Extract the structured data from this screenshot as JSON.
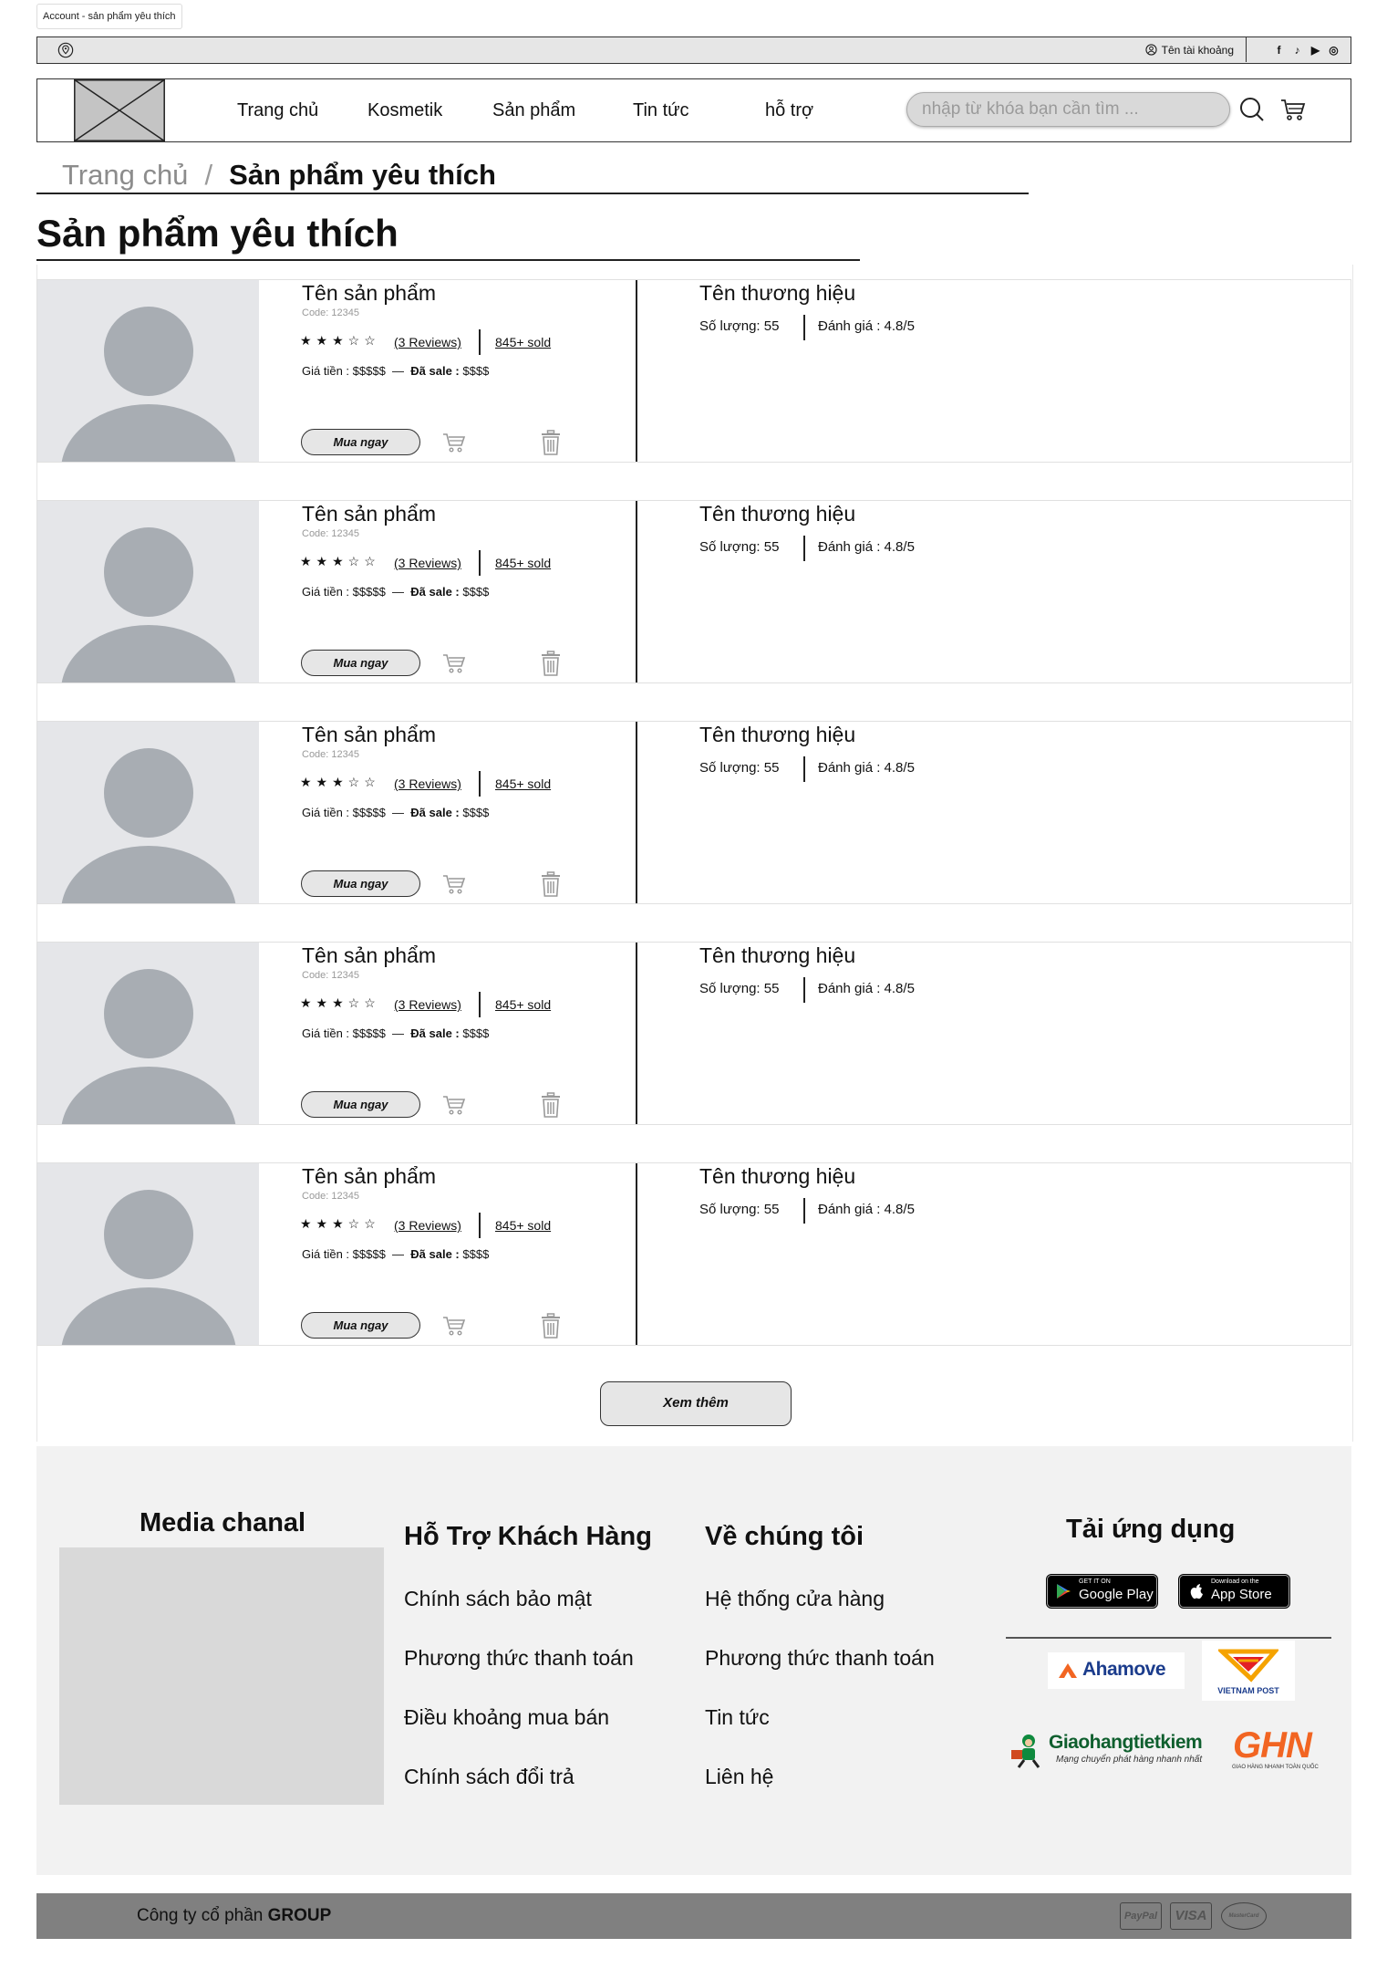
{
  "page_label": "Account - sản phẩm yêu thích",
  "topbar": {
    "account_name": "Tên tài khoảng",
    "socials": [
      "facebook-icon",
      "tiktok-icon",
      "youtube-icon",
      "instagram-icon"
    ]
  },
  "header": {
    "nav": [
      "Trang chủ",
      "Kosmetik",
      "Sản phẩm",
      "Tin tức",
      "hỗ trợ"
    ],
    "search_placeholder": "nhập từ khóa bạn cần tìm ..."
  },
  "breadcrumb": {
    "home": "Trang chủ",
    "separator": "/",
    "current": "Sản phẩm yêu thích"
  },
  "page_title": "Sản phẩm yêu thích",
  "products": [
    {
      "name": "Tên sản phẩm",
      "code": "Code: 12345",
      "stars": "★★★☆☆",
      "reviews": "(3 Reviews)",
      "sold": "845+ sold",
      "price_label": "Giá tiền :",
      "price": "$$$$$",
      "dash": "—",
      "sale_label": "Đã sale :",
      "sale": "$$$$",
      "buy": "Mua ngay",
      "brand": "Tên thương hiệu",
      "quantity": "Số lượng: 55",
      "rating": "Đánh giá : 4.8/5"
    },
    {
      "name": "Tên sản phẩm",
      "code": "Code: 12345",
      "stars": "★★★☆☆",
      "reviews": "(3 Reviews)",
      "sold": "845+ sold",
      "price_label": "Giá tiền :",
      "price": "$$$$$",
      "dash": "—",
      "sale_label": "Đã sale :",
      "sale": "$$$$",
      "buy": "Mua ngay",
      "brand": "Tên thương hiệu",
      "quantity": "Số lượng: 55",
      "rating": "Đánh giá : 4.8/5"
    },
    {
      "name": "Tên sản phẩm",
      "code": "Code: 12345",
      "stars": "★★★☆☆",
      "reviews": "(3 Reviews)",
      "sold": "845+ sold",
      "price_label": "Giá tiền :",
      "price": "$$$$$",
      "dash": "—",
      "sale_label": "Đã sale :",
      "sale": "$$$$",
      "buy": "Mua ngay",
      "brand": "Tên thương hiệu",
      "quantity": "Số lượng: 55",
      "rating": "Đánh giá : 4.8/5"
    },
    {
      "name": "Tên sản phẩm",
      "code": "Code: 12345",
      "stars": "★★★☆☆",
      "reviews": "(3 Reviews)",
      "sold": "845+ sold",
      "price_label": "Giá tiền :",
      "price": "$$$$$",
      "dash": "—",
      "sale_label": "Đã sale :",
      "sale": "$$$$",
      "buy": "Mua ngay",
      "brand": "Tên thương hiệu",
      "quantity": "Số lượng: 55",
      "rating": "Đánh giá : 4.8/5"
    },
    {
      "name": "Tên sản phẩm",
      "code": "Code: 12345",
      "stars": "★★★☆☆",
      "reviews": "(3 Reviews)",
      "sold": "845+ sold",
      "price_label": "Giá tiền :",
      "price": "$$$$$",
      "dash": "—",
      "sale_label": "Đã sale :",
      "sale": "$$$$",
      "buy": "Mua ngay",
      "brand": "Tên thương hiệu",
      "quantity": "Số lượng: 55",
      "rating": "Đánh giá : 4.8/5"
    }
  ],
  "more_button": "Xem thêm",
  "footer": {
    "media_title": "Media chanal",
    "support": {
      "title": "Hỗ Trợ Khách Hàng",
      "links": [
        "Chính sách bảo mật",
        "Phương thức thanh toán",
        "Điều khoảng mua bán",
        "Chính sách đổi trả"
      ]
    },
    "about": {
      "title": "Về chúng tôi",
      "links": [
        "Hệ thống cửa hàng",
        "Phương thức thanh toán",
        "Tin tức",
        "Liên hệ"
      ]
    },
    "app": {
      "title": "Tải ứng dụng",
      "google_small": "GET IT ON",
      "google_big": "Google Play",
      "apple_small": "Download on the",
      "apple_big": "App Store"
    },
    "shipping": {
      "ahamove": "Ahamove",
      "vnpost": "VIETNAM POST",
      "ghtk": "Giaohangtietkiem",
      "ghtk_tagline": "Mạng chuyển phát hàng nhanh nhất",
      "ghn": "GHN",
      "ghn_tagline": "GIAO HÀNG NHANH TOÀN QUỐC"
    }
  },
  "bottom": {
    "company_prefix": "Công ty cổ phần ",
    "company_name": "GROUP",
    "payments": [
      "PayPal",
      "VISA",
      "MasterCard"
    ]
  }
}
